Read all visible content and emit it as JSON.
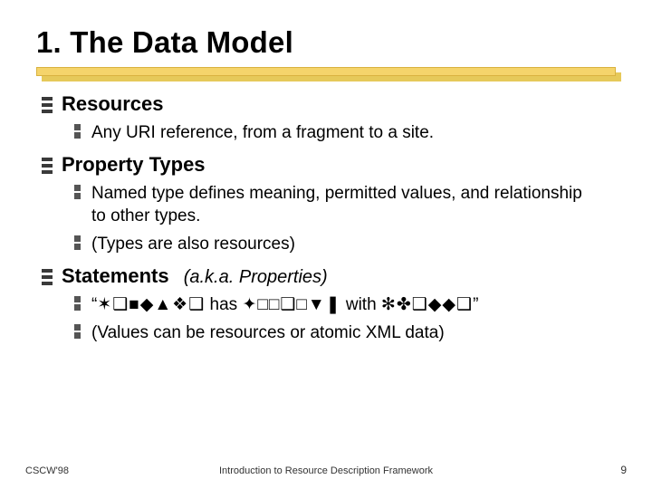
{
  "title": "1. The Data Model",
  "sections": [
    {
      "label": "Resources",
      "aka": "",
      "items": [
        "Any URI reference, from a fragment to a site."
      ]
    },
    {
      "label": "Property Types",
      "aka": "",
      "items": [
        "Named type defines meaning, permitted values, and relationship to other types.",
        "(Types are also resources)"
      ]
    },
    {
      "label": "Statements",
      "aka": "(a.k.a. Properties)",
      "items": [
        "STATEMENT_LINE",
        "(Values can be resources or atomic XML data)"
      ]
    }
  ],
  "statement": {
    "open_quote": "“",
    "resource_glyphs": "✶❑■◆▲❖❑",
    "has": " has ",
    "property_glyphs": "✦□□❑□▼❚",
    "with": " with ",
    "value_glyphs": "✻✤❑◆◆❑",
    "close_quote": "”"
  },
  "footer": {
    "left": "CSCW'98",
    "center": "Introduction to Resource Description Framework",
    "page": "9"
  }
}
